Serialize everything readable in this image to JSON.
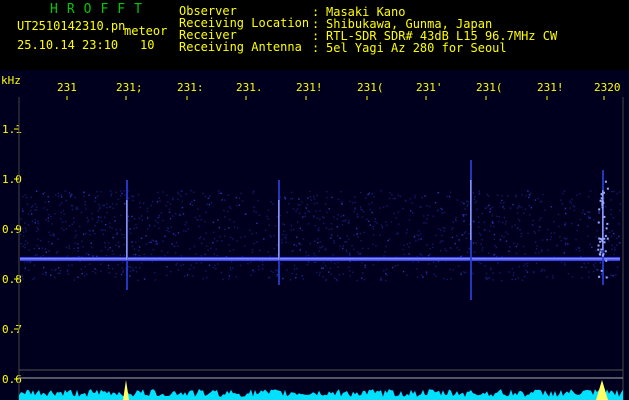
{
  "header": {
    "title": "HROFFT",
    "filename": "UT2510142310.pn",
    "filename_suffix": "meteor",
    "date_time": "25.10.14 23:10",
    "count": "10",
    "fields": [
      {
        "label": "Observer",
        "value": "Masaki Kano"
      },
      {
        "label": "Receiving Location",
        "value": "Shibukawa, Gunma, Japan"
      },
      {
        "label": "Receiver",
        "value": "RTL-SDR SDR# 43dB L15 96.7MHz CW"
      },
      {
        "label": "Receiving Antenna",
        "value": "5el Yagi Az 280 for Seoul"
      }
    ],
    "separator": ":"
  },
  "axis": {
    "unit": "kHz",
    "y_labels": [
      "1.1",
      "1.0",
      "0.9",
      "0.8",
      "0.7",
      "0.6"
    ],
    "time_labels": [
      "231",
      "231;",
      "231:",
      "231.",
      "231!",
      "231(",
      "231'",
      "231(",
      "231!",
      "2320"
    ]
  },
  "colors": {
    "text": "#ffff00",
    "title": "#00c800",
    "signal": "#3c46ff",
    "meteor": "#c8d2ff",
    "bottom_trace": "#00e0ff"
  }
}
